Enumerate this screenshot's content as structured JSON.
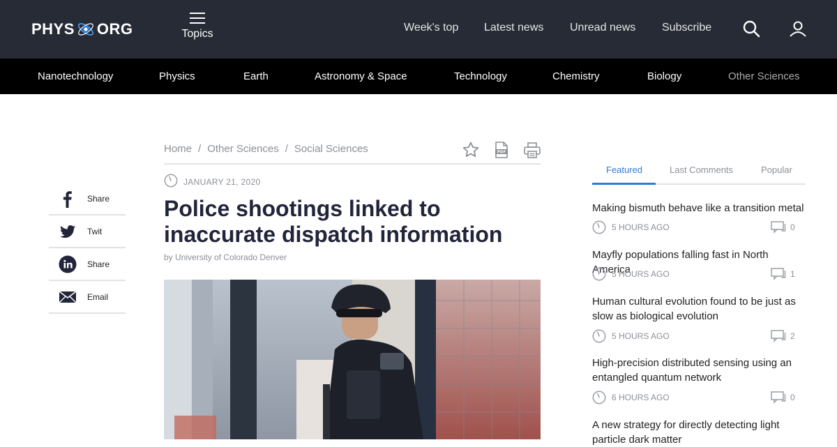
{
  "header": {
    "logo_left": "PHYS",
    "logo_right": "ORG",
    "topics_label": "Topics",
    "nav": [
      "Week's top",
      "Latest news",
      "Unread news",
      "Subscribe"
    ]
  },
  "categories": [
    "Nanotechnology",
    "Physics",
    "Earth",
    "Astronomy & Space",
    "Technology",
    "Chemistry",
    "Biology",
    "Other Sciences"
  ],
  "share": [
    {
      "label": "Share",
      "icon": "facebook-icon"
    },
    {
      "label": "Twit",
      "icon": "twitter-icon"
    },
    {
      "label": "Share",
      "icon": "linkedin-icon"
    },
    {
      "label": "Email",
      "icon": "email-icon"
    }
  ],
  "article": {
    "breadcrumb": [
      "Home",
      "Other Sciences",
      "Social Sciences"
    ],
    "breadcrumb_sep": "/",
    "date": "JANUARY 21, 2020",
    "title": "Police shootings linked to inaccurate dispatch information",
    "byline_prefix": "by",
    "byline_source": "University of Colorado Denver"
  },
  "sidebar": {
    "tabs": [
      "Featured",
      "Last Comments",
      "Popular"
    ],
    "items": [
      {
        "title": "Making bismuth behave like a transition metal",
        "ago": "5 HOURS AGO",
        "comments": "0"
      },
      {
        "title": "Mayfly populations falling fast in North America",
        "ago": "5 HOURS AGO",
        "comments": "1"
      },
      {
        "title": "Human cultural evolution found to be just as slow as biological evolution",
        "ago": "5 HOURS AGO",
        "comments": "2"
      },
      {
        "title": "High-precision distributed sensing using an entangled quantum network",
        "ago": "6 HOURS AGO",
        "comments": "0"
      },
      {
        "title": "A new strategy for directly detecting light particle dark matter",
        "ago": "",
        "comments": ""
      }
    ]
  },
  "colors": {
    "header_bg": "#262b35",
    "catbar_bg": "#000000",
    "accent": "#2f7bd6",
    "muted": "#8c8f96"
  }
}
